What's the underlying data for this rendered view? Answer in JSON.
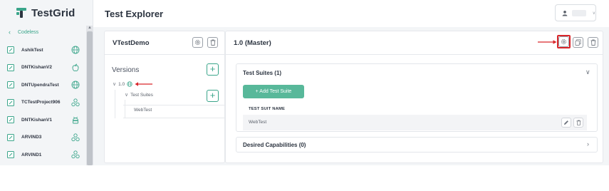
{
  "app": {
    "brand": "TestGrid",
    "page_title": "Test Explorer"
  },
  "colors": {
    "accent": "#3aa58a",
    "button_green": "#58b89a",
    "annotation_red": "#d9262b"
  },
  "sidebar": {
    "back_label": "Codeless",
    "items": [
      {
        "label": "AshikTest",
        "platform_icon": "globe-icon"
      },
      {
        "label": "DNTKishanV2",
        "platform_icon": "apple-icon"
      },
      {
        "label": "DNTUpendraTest",
        "platform_icon": "globe-icon"
      },
      {
        "label": "TCTestProject906",
        "platform_icon": "multi-platform-icon"
      },
      {
        "label": "DNTKishanV1",
        "platform_icon": "android-icon"
      },
      {
        "label": "ARVIND3",
        "platform_icon": "multi-platform-icon"
      },
      {
        "label": "ARVIND1",
        "platform_icon": "multi-platform-icon"
      }
    ]
  },
  "project": {
    "title": "VTestDemo",
    "versions_label": "Versions",
    "tree": {
      "version": "1.0",
      "folder": "Test Suites",
      "suite": "WebTest"
    }
  },
  "version_panel": {
    "title": "1.0 (Master)",
    "test_suites_title": "Test Suites (1)",
    "add_suite_label": "+ Add Test Suite",
    "table_header": "TEST SUIT NAME",
    "rows": [
      {
        "name": "WebTest"
      }
    ],
    "desired_capabilities_title": "Desired Capabilities (0)"
  }
}
